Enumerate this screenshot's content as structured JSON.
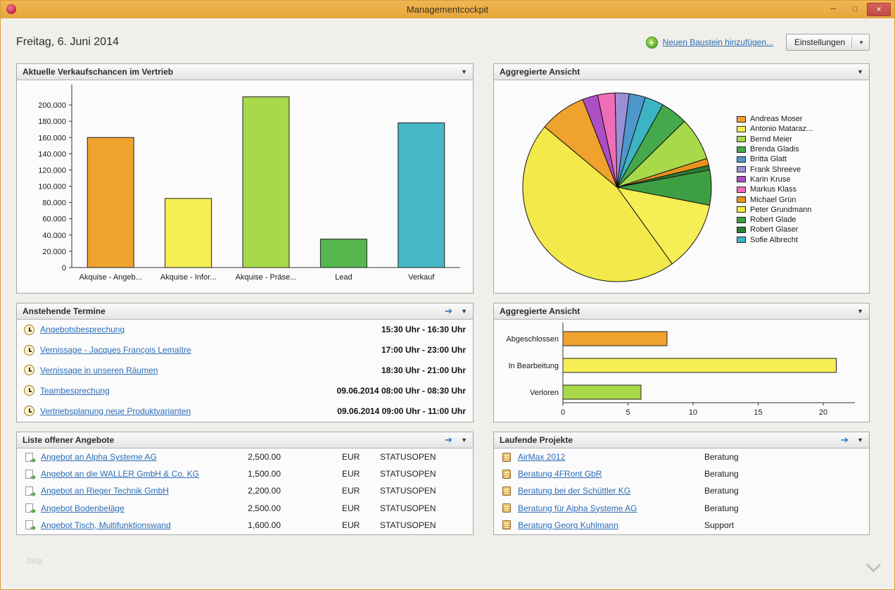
{
  "window": {
    "title": "Managementcockpit",
    "minimize": "─",
    "maximize": "□",
    "close": "×"
  },
  "icons": {
    "caret_down": "▼",
    "forward_arrow": "➔",
    "plus": "+"
  },
  "header": {
    "date": "Freitag, 6. Juni 2014",
    "add_link": "Neuen Baustein hinzufügen...",
    "settings": "Einstellungen"
  },
  "panels": {
    "opportunities": {
      "title": "Aktuelle Verkaufschancen im Vertrieb"
    },
    "aggregated_pie": {
      "title": "Aggregierte Ansicht"
    },
    "appointments": {
      "title": "Anstehende Termine",
      "items": [
        {
          "label": "Angebotsbesprechung",
          "time": "15:30 Uhr - 16:30 Uhr"
        },
        {
          "label": "Vernissage - Jacques François Lemaître",
          "time": "17:00 Uhr - 23:00 Uhr"
        },
        {
          "label": "Vernissage in unseren Räumen",
          "time": "18:30 Uhr - 21:00 Uhr"
        },
        {
          "label": "Teambesprechung",
          "time": "09.06.2014 08:00 Uhr - 08:30 Uhr"
        },
        {
          "label": "Vertriebsplanung neue Produktvarianten",
          "time": "09.06.2014 09:00 Uhr - 11:00 Uhr"
        }
      ]
    },
    "aggregated_bar": {
      "title": "Aggregierte Ansicht"
    },
    "offers": {
      "title": "Liste offener Angebote",
      "items": [
        {
          "label": "Angebot an Alpha Systeme AG",
          "amount": "2,500.00",
          "currency": "EUR",
          "status": "STATUSOPEN"
        },
        {
          "label": "Angebot an die WALLER GmbH & Co. KG",
          "amount": "1,500.00",
          "currency": "EUR",
          "status": "STATUSOPEN"
        },
        {
          "label": "Angebot an Rieger Technik GmbH",
          "amount": "2,200.00",
          "currency": "EUR",
          "status": "STATUSOPEN"
        },
        {
          "label": "Angebot Bodenbeläge",
          "amount": "2,500.00",
          "currency": "EUR",
          "status": "STATUSOPEN"
        },
        {
          "label": "Angebot Tisch, Multifunktionswand",
          "amount": "1,600.00",
          "currency": "EUR",
          "status": "STATUSOPEN"
        }
      ]
    },
    "projects": {
      "title": "Laufende Projekte",
      "items": [
        {
          "label": "AirMax 2012",
          "type": "Beratung"
        },
        {
          "label": "Beratung 4FRont GbR",
          "type": "Beratung"
        },
        {
          "label": "Beratung bei der Schüttler KG",
          "type": "Beratung"
        },
        {
          "label": "Beratung für Alpha Systeme AG",
          "type": "Beratung"
        },
        {
          "label": "Beratung Georg Kuhlmann",
          "type": "Support"
        }
      ]
    }
  },
  "footer": {
    "blog_label": "blog"
  },
  "chart_data": [
    {
      "type": "bar",
      "title": "Aktuelle Verkaufschancen im Vertrieb",
      "categories": [
        "Akquise - Angeb...",
        "Akquise - Infor...",
        "Akquise - Präse...",
        "Lead",
        "Verkauf"
      ],
      "values": [
        160000,
        85000,
        210000,
        35000,
        178000
      ],
      "colors": [
        "#f0a22e",
        "#f5ee55",
        "#a8d94a",
        "#55b74e",
        "#46b8c8"
      ],
      "ylim": [
        0,
        220000
      ],
      "yticks": [
        0,
        20000,
        40000,
        60000,
        80000,
        100000,
        120000,
        140000,
        160000,
        180000,
        200000
      ],
      "ytick_labels": [
        "0",
        "20.000",
        "40.000",
        "60.000",
        "80.000",
        "100.000",
        "120.000",
        "140.000",
        "160.000",
        "180.000",
        "200.000"
      ],
      "grid": false,
      "legend_position": "none"
    },
    {
      "type": "pie",
      "title": "Aggregierte Ansicht",
      "start_angle_deg": -12,
      "slices": [
        {
          "label": "Markus Klass",
          "value": 3.0,
          "color": "#ef6eb8"
        },
        {
          "label": "Frank Shreeve",
          "value": 2.4,
          "color": "#9a8fd8"
        },
        {
          "label": "Britta Glatt",
          "value": 2.8,
          "color": "#4e97cd"
        },
        {
          "label": "Sofie Albrecht",
          "value": 3.2,
          "color": "#3db4c4"
        },
        {
          "label": "Brenda Gladis",
          "value": 4.6,
          "color": "#45a84a"
        },
        {
          "label": "Bernd Meier",
          "value": 7.4,
          "color": "#a8d94a"
        },
        {
          "label": "Michael Grün",
          "value": 1.2,
          "color": "#e8941f"
        },
        {
          "label": "Robert Glaser",
          "value": 0.8,
          "color": "#2e7d32"
        },
        {
          "label": "Robert Glade",
          "value": 6.0,
          "color": "#3e9e44"
        },
        {
          "label": "Antonio Mataraz...",
          "value": 12.0,
          "color": "#f5ee55"
        },
        {
          "label": "Peter Grundmann",
          "value": 46.0,
          "color": "#f3e94a"
        },
        {
          "label": "Andreas Moser",
          "value": 8.0,
          "color": "#f0a22e"
        },
        {
          "label": "Karin Kruse",
          "value": 2.6,
          "color": "#ad4fc4"
        }
      ],
      "legend_position": "right",
      "legend": [
        {
          "label": "Andreas Moser",
          "color": "#f0a22e"
        },
        {
          "label": "Antonio Mataraz...",
          "color": "#f5ee55"
        },
        {
          "label": "Bernd Meier",
          "color": "#a8d94a"
        },
        {
          "label": "Brenda Gladis",
          "color": "#45a84a"
        },
        {
          "label": "Britta Glatt",
          "color": "#4e97cd"
        },
        {
          "label": "Frank Shreeve",
          "color": "#9a8fd8"
        },
        {
          "label": "Karin Kruse",
          "color": "#ad4fc4"
        },
        {
          "label": "Markus Klass",
          "color": "#ef6eb8"
        },
        {
          "label": "Michael Grün",
          "color": "#e8941f"
        },
        {
          "label": "Peter Grundmann",
          "color": "#f3e94a"
        },
        {
          "label": "Robert Glade",
          "color": "#3e9e44"
        },
        {
          "label": "Robert Glaser",
          "color": "#2e7d32"
        },
        {
          "label": "Sofie Albrecht",
          "color": "#3db4c4"
        }
      ]
    },
    {
      "type": "bar",
      "orientation": "horizontal",
      "title": "Aggregierte Ansicht",
      "categories": [
        "Abgeschlossen",
        "In Bearbeitung",
        "Verloren"
      ],
      "values": [
        8,
        21,
        6
      ],
      "colors": [
        "#f0a22e",
        "#f5ee55",
        "#a8d94a"
      ],
      "xlim": [
        0,
        22
      ],
      "xticks": [
        0,
        5,
        10,
        15,
        20
      ],
      "grid": false
    }
  ]
}
